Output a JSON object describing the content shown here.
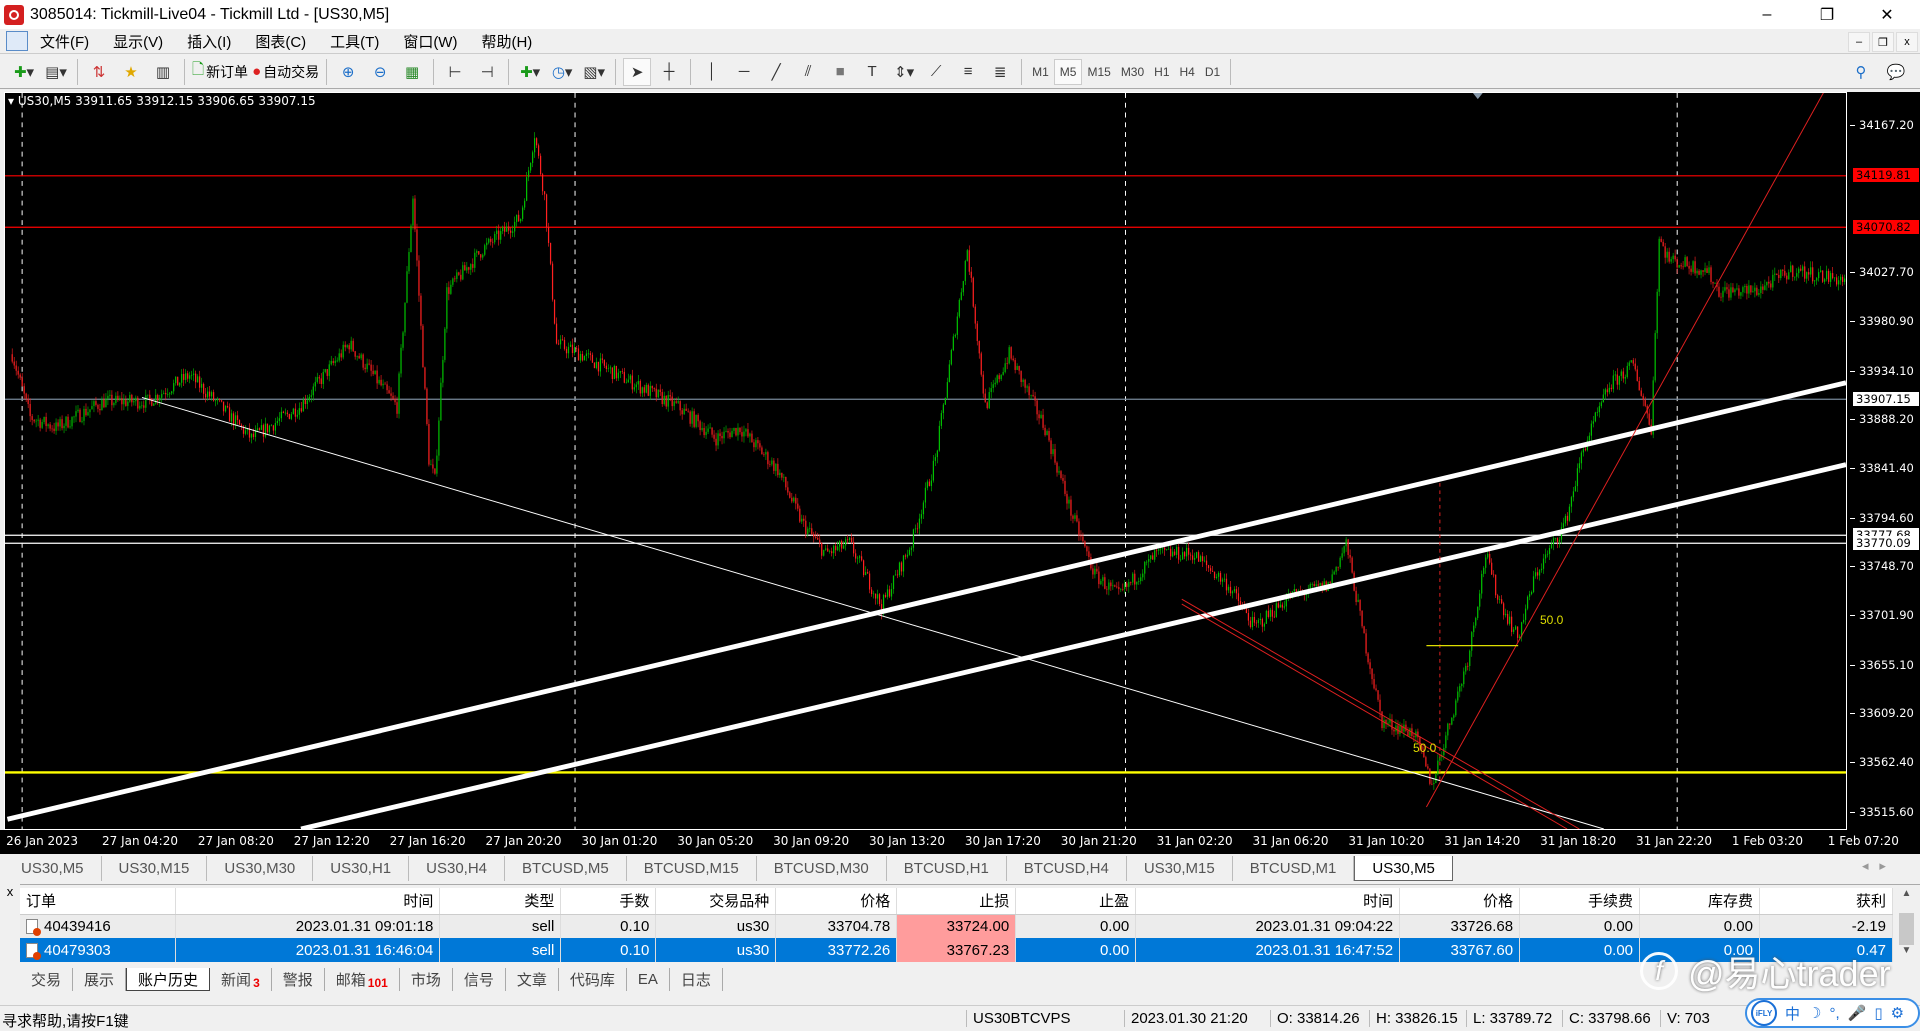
{
  "window": {
    "title": "3085014: Tickmill-Live04 - Tickmill Ltd - [US30,M5]",
    "minimize": "–",
    "restore": "❐",
    "close": "✕"
  },
  "menu": [
    "文件(F)",
    "显示(V)",
    "插入(I)",
    "图表(C)",
    "工具(T)",
    "窗口(W)",
    "帮助(H)"
  ],
  "mdi": {
    "minimize": "–",
    "restore": "❐",
    "close": "x"
  },
  "toolbar": {
    "new_order": "新订单",
    "auto_trading": "自动交易",
    "timeframes": [
      "M1",
      "M5",
      "M15",
      "M30",
      "H1",
      "H4",
      "D1"
    ],
    "active_timeframe": "M5"
  },
  "chart": {
    "info": "US30,M5  33911.65 33912.15 33906.65 33907.15",
    "price_ticks": [
      "34167.20",
      "34027.70",
      "33980.90",
      "33934.10",
      "33888.20",
      "33841.40",
      "33794.60",
      "33748.70",
      "33701.90",
      "33655.10",
      "33609.20",
      "33562.40",
      "33515.60"
    ],
    "price_tags": [
      {
        "value": "34119.81",
        "color": "#ff0000"
      },
      {
        "value": "34070.82",
        "color": "#ff0000"
      },
      {
        "value": "33907.15",
        "color": "#ffffff"
      },
      {
        "value": "33777.68",
        "color": "#ffffff"
      },
      {
        "value": "33770.09",
        "color": "#ffffff"
      }
    ],
    "hlines": [
      {
        "price": 34119.81,
        "color": "#ff0000"
      },
      {
        "price": 34070.82,
        "color": "#ff0000"
      },
      {
        "price": 33907.15,
        "color": "#778899"
      },
      {
        "price": 33777.68,
        "color": "#ffffff"
      },
      {
        "price": 33770.09,
        "color": "#ffffff"
      },
      {
        "price": 33552.0,
        "color": "#ffff00"
      }
    ],
    "fib_labels": [
      "50.0",
      "50.0"
    ],
    "time_labels": [
      "26 Jan 2023",
      "27 Jan 04:20",
      "27 Jan 08:20",
      "27 Jan 12:20",
      "27 Jan 16:20",
      "27 Jan 20:20",
      "30 Jan 01:20",
      "30 Jan 05:20",
      "30 Jan 09:20",
      "30 Jan 13:20",
      "30 Jan 17:20",
      "30 Jan 21:20",
      "31 Jan 02:20",
      "31 Jan 06:20",
      "31 Jan 10:20",
      "31 Jan 14:20",
      "31 Jan 18:20",
      "31 Jan 22:20",
      "1 Feb 03:20",
      "1 Feb 07:20"
    ],
    "price_range": [
      33515.6,
      34167.2
    ],
    "bull_color": "#00c000",
    "bear_color": "#ff2020",
    "price_path": [
      [
        3,
        33950
      ],
      [
        12,
        33890
      ],
      [
        25,
        33880
      ],
      [
        49,
        33905
      ],
      [
        71,
        33905
      ],
      [
        92,
        33930
      ],
      [
        123,
        33870
      ],
      [
        147,
        33900
      ],
      [
        172,
        33960
      ],
      [
        184,
        33930
      ],
      [
        196,
        33900
      ],
      [
        204,
        34100
      ],
      [
        212,
        33850
      ],
      [
        215,
        33830
      ],
      [
        221,
        34010
      ],
      [
        239,
        34050
      ],
      [
        258,
        34080
      ],
      [
        265,
        34160
      ],
      [
        270,
        34100
      ],
      [
        276,
        33960
      ],
      [
        288,
        33950
      ],
      [
        307,
        33930
      ],
      [
        337,
        33900
      ],
      [
        356,
        33870
      ],
      [
        368,
        33880
      ],
      [
        387,
        33840
      ],
      [
        399,
        33790
      ],
      [
        411,
        33760
      ],
      [
        423,
        33770
      ],
      [
        439,
        33710
      ],
      [
        454,
        33770
      ],
      [
        466,
        33850
      ],
      [
        482,
        34050
      ],
      [
        491,
        33900
      ],
      [
        503,
        33950
      ],
      [
        521,
        33880
      ],
      [
        534,
        33800
      ],
      [
        546,
        33740
      ],
      [
        558,
        33720
      ],
      [
        577,
        33760
      ],
      [
        595,
        33760
      ],
      [
        613,
        33730
      ],
      [
        626,
        33690
      ],
      [
        644,
        33720
      ],
      [
        663,
        33730
      ],
      [
        672,
        33770
      ],
      [
        681,
        33680
      ],
      [
        690,
        33600
      ],
      [
        706,
        33590
      ],
      [
        715,
        33540
      ],
      [
        724,
        33600
      ],
      [
        733,
        33660
      ],
      [
        742,
        33760
      ],
      [
        748,
        33720
      ],
      [
        758,
        33680
      ],
      [
        767,
        33740
      ],
      [
        782,
        33790
      ],
      [
        791,
        33860
      ],
      [
        804,
        33920
      ],
      [
        816,
        33940
      ],
      [
        825,
        33880
      ],
      [
        829,
        34060
      ],
      [
        834,
        34040
      ],
      [
        853,
        34030
      ],
      [
        859,
        34010
      ],
      [
        877,
        34010
      ],
      [
        896,
        34030
      ],
      [
        923,
        34020
      ]
    ]
  },
  "chart_tabs": [
    "US30,M5",
    "US30,M15",
    "US30,M30",
    "US30,H1",
    "US30,H4",
    "BTCUSD,M5",
    "BTCUSD,M15",
    "BTCUSD,M30",
    "BTCUSD,H1",
    "BTCUSD,H4",
    "US30,M15",
    "BTCUSD,M1",
    "US30,M5"
  ],
  "terminal": {
    "columns": [
      "订单",
      "时间",
      "类型",
      "手数",
      "交易品种",
      "价格",
      "止损",
      "止盈",
      "时间",
      "价格",
      "手续费",
      "库存费",
      "获利"
    ],
    "rows": [
      [
        "40439416",
        "2023.01.31 09:01:18",
        "sell",
        "0.10",
        "us30",
        "33704.78",
        "33724.00",
        "0.00",
        "2023.01.31 09:04:22",
        "33726.68",
        "0.00",
        "0.00",
        "-2.19"
      ],
      [
        "40479303",
        "2023.01.31 16:46:04",
        "sell",
        "0.10",
        "us30",
        "33772.26",
        "33767.23",
        "0.00",
        "2023.01.31 16:47:52",
        "33767.60",
        "0.00",
        "0.00",
        "0.47"
      ]
    ],
    "tabs": [
      {
        "label": "交易"
      },
      {
        "label": "展示"
      },
      {
        "label": "账户历史",
        "active": true
      },
      {
        "label": "新闻",
        "badge": "3"
      },
      {
        "label": "警报"
      },
      {
        "label": "邮箱",
        "badge": "101"
      },
      {
        "label": "市场"
      },
      {
        "label": "信号"
      },
      {
        "label": "文章"
      },
      {
        "label": "代码库"
      },
      {
        "label": "EA"
      },
      {
        "label": "日志"
      }
    ]
  },
  "status": {
    "help": "寻求帮助,请按F1键",
    "profile": "US30BTCVPS",
    "datetime": "2023.01.30 21:20",
    "open": "O: 33814.26",
    "high": "H: 33826.15",
    "low": "L: 33789.72",
    "close": "C: 33798.66",
    "volume": "V: 703"
  },
  "watermark": "@易心trader",
  "ime": {
    "brand": "iFLY",
    "lang": "中"
  }
}
